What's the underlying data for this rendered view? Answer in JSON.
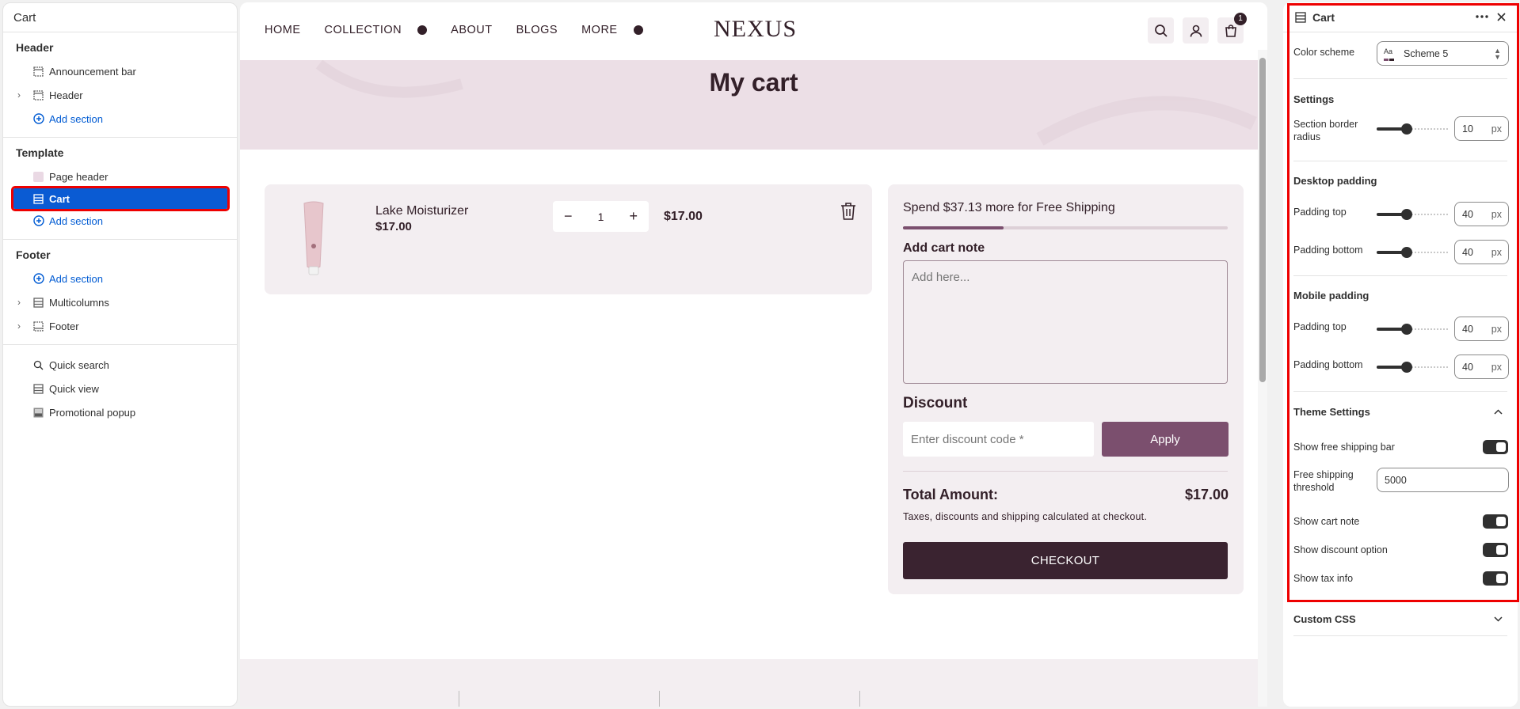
{
  "left_panel": {
    "title": "Cart",
    "header_group": {
      "title": "Header",
      "items": [
        "Announcement bar",
        "Header"
      ],
      "add_label": "Add section"
    },
    "template_group": {
      "title": "Template",
      "items": [
        "Page header",
        "Cart"
      ],
      "add_label": "Add section"
    },
    "footer_group": {
      "title": "Footer",
      "add_label": "Add section",
      "items": [
        "Multicolumns",
        "Footer"
      ]
    },
    "utility_items": [
      "Quick search",
      "Quick view",
      "Promotional popup"
    ]
  },
  "store": {
    "nav": [
      "HOME",
      "COLLECTION",
      "ABOUT",
      "BLOGS",
      "MORE"
    ],
    "logo": "NEXUS",
    "cart_count": "1",
    "page_title": "My cart",
    "line_item": {
      "name": "Lake Moisturizer",
      "price": "$17.00",
      "quantity": "1",
      "line_price": "$17.00"
    },
    "summary": {
      "shipping_message": "Spend $37.13 more for Free Shipping",
      "shipping_progress": 0.31,
      "note_label": "Add cart note",
      "note_placeholder": "Add here...",
      "discount_label": "Discount",
      "discount_placeholder": "Enter discount code *",
      "apply_label": "Apply",
      "total_label": "Total Amount:",
      "total_value": "$17.00",
      "tax_info": "Taxes, discounts and shipping calculated at checkout.",
      "checkout_label": "CHECKOUT"
    }
  },
  "right_panel": {
    "title": "Cart",
    "color_scheme_label": "Color scheme",
    "color_scheme_value": "Scheme 5",
    "settings_title": "Settings",
    "border_radius_label": "Section border radius",
    "border_radius_value": "10",
    "unit": "px",
    "desktop_title": "Desktop padding",
    "desktop_top_label": "Padding top",
    "desktop_top_value": "40",
    "desktop_bottom_label": "Padding bottom",
    "desktop_bottom_value": "40",
    "mobile_title": "Mobile padding",
    "mobile_top_label": "Padding top",
    "mobile_top_value": "40",
    "mobile_bottom_label": "Padding bottom",
    "mobile_bottom_value": "40",
    "theme_title": "Theme Settings",
    "show_free_shipping_label": "Show free shipping bar",
    "threshold_label": "Free shipping threshold",
    "threshold_value": "5000",
    "show_cart_note_label": "Show cart note",
    "show_discount_label": "Show discount option",
    "show_tax_label": "Show tax info",
    "custom_css_title": "Custom CSS"
  },
  "colors": {
    "brand": "#332029",
    "accent": "#7b4f6e",
    "selection": "#0a5bd3",
    "highlight": "#ee0000"
  }
}
